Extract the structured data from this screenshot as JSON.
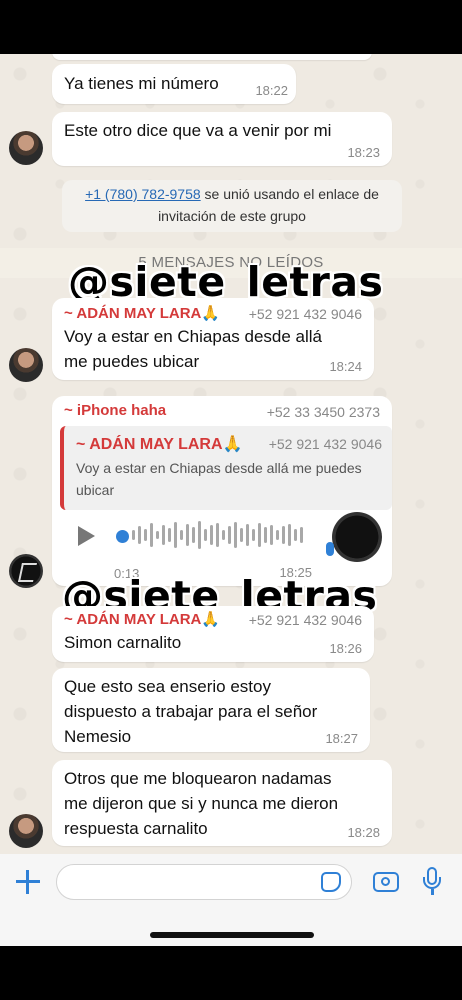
{
  "messages": {
    "m1": {
      "text": "Ya tienes mi número",
      "time": "18:22"
    },
    "m2": {
      "text": "Este otro dice que va a venir por mi",
      "time": "18:23"
    },
    "system": {
      "phone": "+1 (780) 782-9758",
      "text": " se unió usando el enlace de invitación de este grupo"
    },
    "unread": "5 MENSAJES NO LEÍDOS",
    "m3": {
      "sender": "~ ADÁN MAY LARA🙏",
      "phone": "+52 921 432 9046",
      "line1": "Voy a estar en Chiapas desde allá",
      "line2": "me puedes ubicar",
      "time": "18:24"
    },
    "m4": {
      "sender": "~ iPhone   haha",
      "phone": "+52 33 3450 2373",
      "quote_sender": "~ ADÁN MAY LARA🙏",
      "quote_phone": "+52 921 432 9046",
      "quote_line1": "Voy a estar en Chiapas desde allá me puedes",
      "quote_line2": "ubicar",
      "duration": "0:13",
      "time": "18:25"
    },
    "m5": {
      "sender": "~ ADÁN MAY LARA🙏",
      "phone": "+52 921 432 9046",
      "text": "Simon carnalito",
      "time": "18:26"
    },
    "m6": {
      "line1": "Que esto sea enserio estoy",
      "line2": "dispuesto a trabajar para el señor",
      "line3": "Nemesio",
      "time": "18:27"
    },
    "m7": {
      "line1": "Otros que me bloquearon nadamas",
      "line2": "me dijeron que si y nunca me dieron",
      "line3": "respuesta carnalito",
      "time": "18:28"
    }
  },
  "watermark": "@siete_letras",
  "icons": {
    "add": "plus-icon",
    "sticker": "sticker-icon",
    "camera": "camera-icon",
    "mic": "microphone-icon",
    "play": "play-icon"
  },
  "colors": {
    "accent": "#2f80d6",
    "sender": "#d43a3a",
    "link": "#2769b5"
  }
}
